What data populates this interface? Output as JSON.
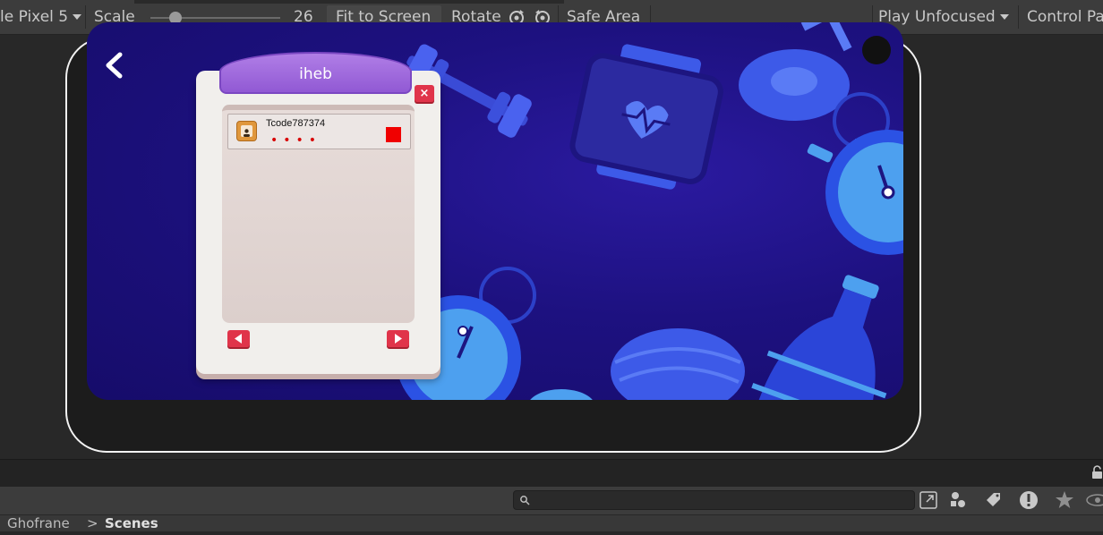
{
  "toolbar": {
    "device_label": "le Pixel 5",
    "scale_label": "Scale",
    "scale_value": "26",
    "fit_label": "Fit to Screen",
    "rotate_label": "Rotate",
    "safe_area_label": "Safe Area",
    "play_mode_label": "Play Unfocused",
    "control_label": "Control Pa"
  },
  "popup": {
    "title": "iheb",
    "close_glyph": "×",
    "items": [
      {
        "name": "Tcode787374",
        "masked": "••••"
      }
    ],
    "colors": {
      "header": "#9b63d8",
      "button": "#e0344a",
      "status": "#f00000"
    }
  },
  "bottom": {
    "breadcrumb_root": "Ghofrane",
    "breadcrumb_sep": ">",
    "breadcrumb_current": "Scenes"
  },
  "icons": [
    "back-chevron-icon",
    "rotate-cw-icon",
    "rotate-ccw-icon",
    "search-icon",
    "lock-icon",
    "scene-icon",
    "tag-icon",
    "warning-icon",
    "star-icon"
  ]
}
